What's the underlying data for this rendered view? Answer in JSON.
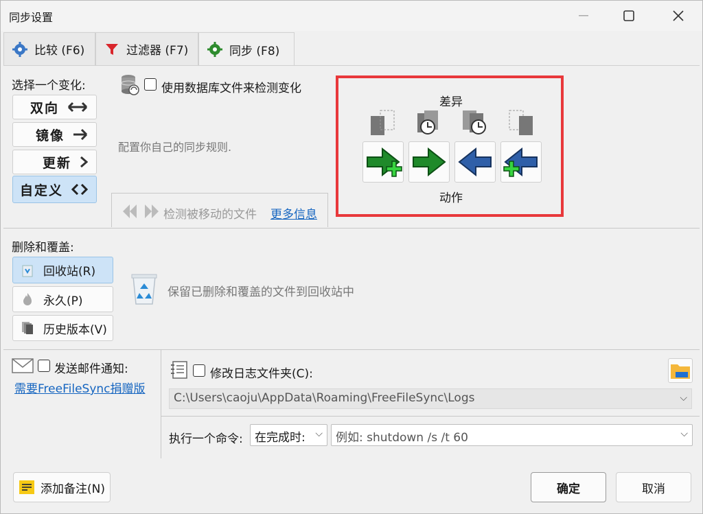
{
  "window": {
    "title": "同步设置"
  },
  "tabs": [
    {
      "label": "比较 (F6)",
      "icon": "gear-blue-icon"
    },
    {
      "label": "过滤器 (F7)",
      "icon": "funnel-red-icon"
    },
    {
      "label": "同步 (F8)",
      "icon": "gear-green-icon"
    }
  ],
  "variants": {
    "heading": "选择一个变化:",
    "items": [
      {
        "label": "双向",
        "symbol": "⟷"
      },
      {
        "label": "镜像",
        "symbol": "➜"
      },
      {
        "label": "更新",
        "symbol": "❯"
      },
      {
        "label": "自定义",
        "symbol": "<>"
      }
    ],
    "selected": "自定义"
  },
  "db_option": {
    "label": "使用数据库文件来检测变化",
    "checked": false
  },
  "description": "配置你自己的同步规则.",
  "move_detect": {
    "label": "检测被移动的文件",
    "link": "更多信息"
  },
  "actions_panel": {
    "top_label": "差异",
    "bottom_label": "动作"
  },
  "deletion": {
    "heading": "删除和覆盖:",
    "options": [
      {
        "label": "回收站(R)",
        "icon": "recycle-bin-icon"
      },
      {
        "label": "永久(P)",
        "icon": "flame-icon"
      },
      {
        "label": "历史版本(V)",
        "icon": "versions-icon"
      }
    ],
    "selected": "回收站(R)",
    "description": "保留已删除和覆盖的文件到回收站中"
  },
  "email": {
    "label": "发送邮件通知:",
    "link": "需要FreeFileSync捐赠版",
    "checked": false
  },
  "log": {
    "label": "修改日志文件夹(C):",
    "path": "C:\\Users\\caoju\\AppData\\Roaming\\FreeFileSync\\Logs",
    "checked": false
  },
  "command": {
    "label": "执行一个命令:",
    "when": "在完成时:",
    "placeholder": "例如: shutdown /s /t 60"
  },
  "footer": {
    "add_note": "添加备注(N)",
    "ok": "确定",
    "cancel": "取消"
  },
  "colors": {
    "selected": "#cde3f7",
    "highlight": "#e8383b",
    "link": "#1565c0"
  }
}
